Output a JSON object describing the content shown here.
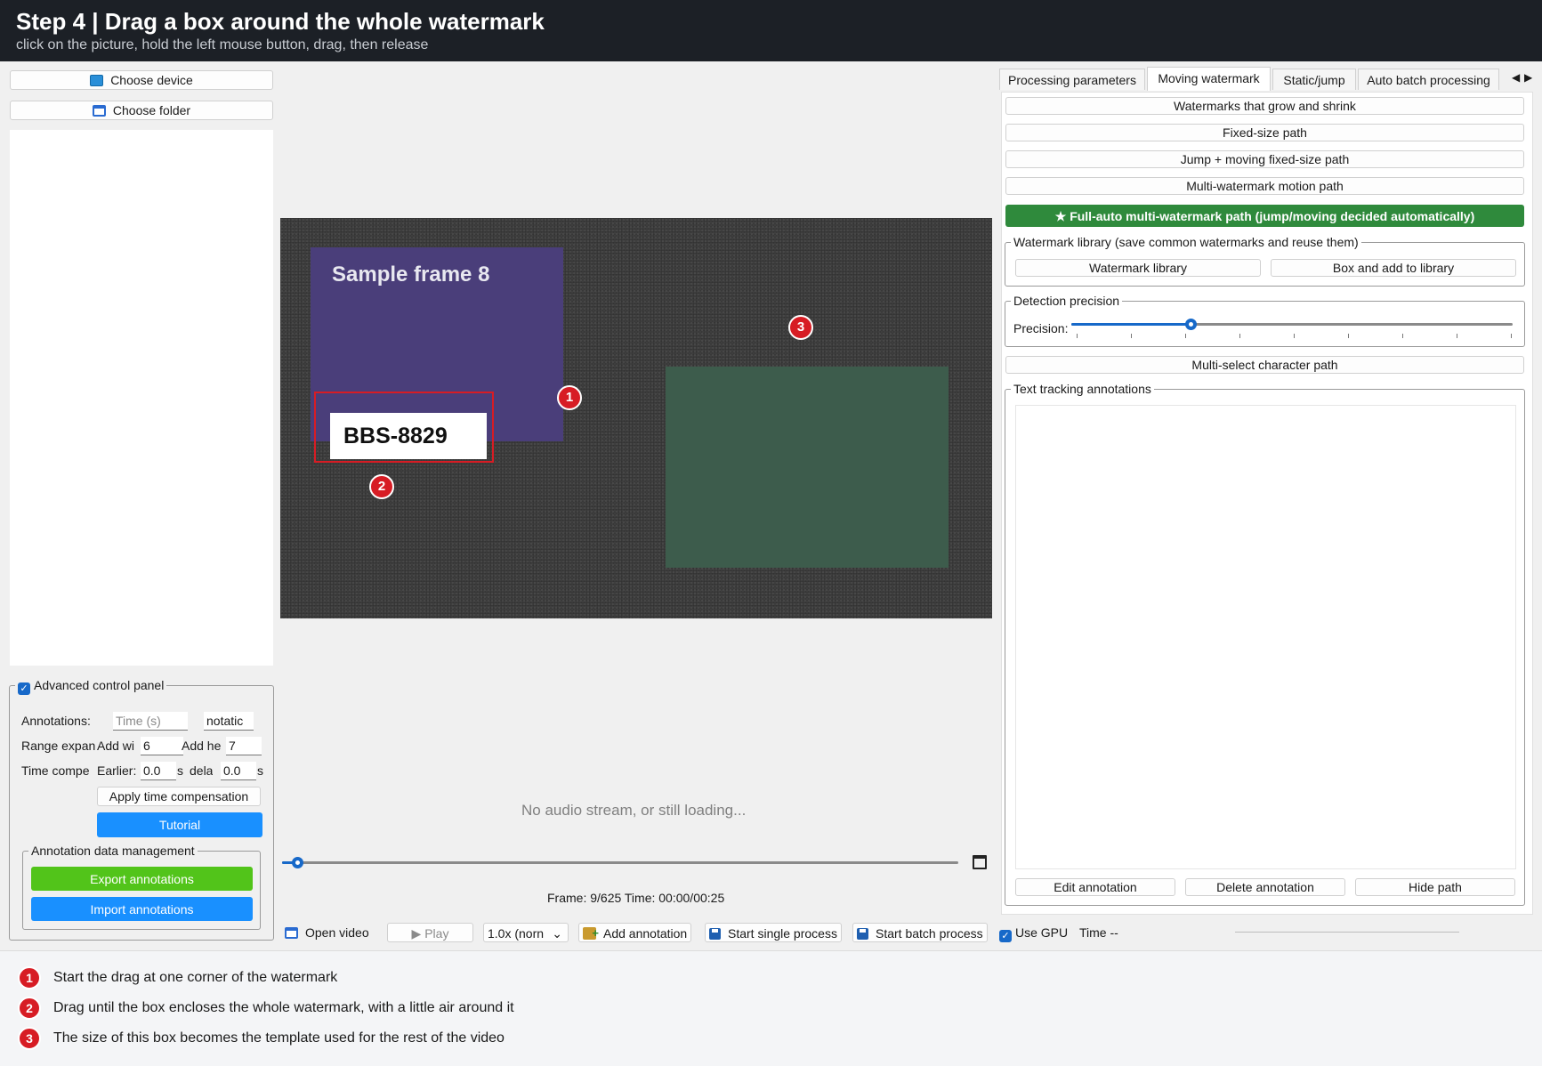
{
  "header": {
    "title": "Step 4  |  Drag a box around the whole watermark",
    "subtitle": "click on the picture, hold the left mouse button, drag, then release"
  },
  "left": {
    "choose_device": "Choose device",
    "choose_folder": "Choose folder",
    "advanced_panel": "Advanced control panel",
    "annotations_label": "Annotations:",
    "annotations_time_placeholder": "Time (s)",
    "annotations_extra": "notatic",
    "range_label": "Range expan",
    "add_width_label": "Add wi",
    "add_width_value": "6",
    "add_height_label": "Add he",
    "add_height_value": "7",
    "time_label": "Time compe",
    "earlier_label": "Earlier:",
    "earlier_value": "0.0",
    "earlier_unit": "s",
    "delay_label": "dela",
    "delay_value": "0.0",
    "delay_unit": "s",
    "apply_time": "Apply time compensation",
    "tutorial": "Tutorial",
    "data_mgmt": "Annotation data management",
    "export": "Export annotations",
    "import": "Import annotations"
  },
  "canvas": {
    "sample_label": "Sample frame 8",
    "watermark_text": "BBS-8829",
    "markers": [
      "1",
      "2",
      "3"
    ]
  },
  "player": {
    "no_audio": "No audio stream, or still loading...",
    "timeline_progress": 0.02,
    "frame_info": "Frame: 9/625  Time: 00:00/00:25",
    "open_video": "Open video",
    "play": "Play",
    "speed": "1.0x (norn",
    "add_annotation": "Add annotation",
    "start_single": "Start single process",
    "start_batch": "Start batch process",
    "use_gpu": "Use GPU",
    "time": "Time --"
  },
  "right": {
    "tabs": [
      "Processing  parameters",
      "Moving watermark",
      "Static/jump",
      "Auto batch processing"
    ],
    "buttons": [
      "Watermarks that grow and shrink",
      "Fixed-size path",
      "Jump + moving fixed-size path",
      "Multi-watermark motion path"
    ],
    "full_auto": "★ Full-auto multi-watermark path (jump/moving decided automatically)",
    "library_group": "Watermark library (save common watermarks and reuse them)",
    "library_btn": "Watermark library",
    "box_add_btn": "Box and add to library",
    "precision_group": "Detection precision",
    "precision_label": "Precision:",
    "precision_value": 0.27,
    "multi_select": "Multi-select character path",
    "tracking_group": "Text tracking annotations",
    "edit_btn": "Edit annotation",
    "delete_btn": "Delete annotation",
    "hide_btn": "Hide path"
  },
  "footer": {
    "steps": [
      {
        "num": "1",
        "text": "Start the drag at one corner of the watermark"
      },
      {
        "num": "2",
        "text": "Drag until the box encloses the whole watermark, with a little air around it"
      },
      {
        "num": "3",
        "text": "The size of this box becomes the template used for the rest of the video"
      }
    ]
  },
  "colors": {
    "accent_blue": "#1990ff",
    "export_green": "#52c41a",
    "full_auto_green": "#2f8a3c",
    "marker_red": "#d71c24",
    "selection_red": "#d71c24"
  }
}
